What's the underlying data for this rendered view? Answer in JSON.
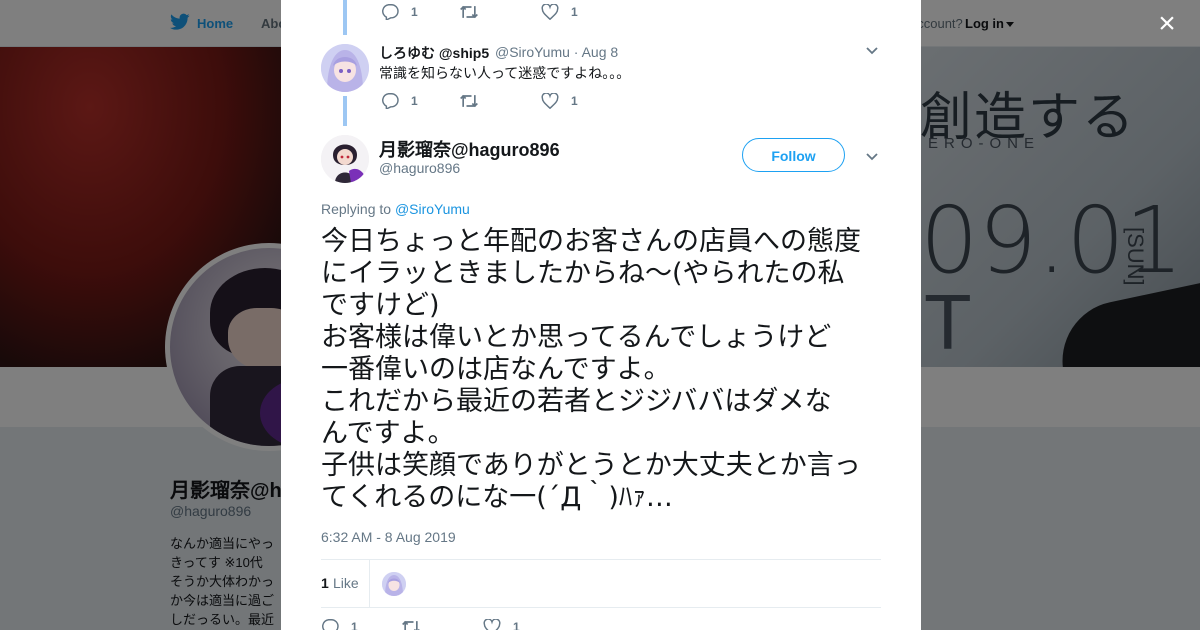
{
  "nav": {
    "home": "Home",
    "about": "Abo",
    "account_prompt": "account?",
    "login": "Log in"
  },
  "banner": {
    "kanji": "創造する",
    "subtitle": "ERO-ONE",
    "date": "09.01",
    "day": "[SUN]",
    "partial": "T"
  },
  "profile": {
    "name": "月影瑠奈@h",
    "handle": "@haguro896",
    "bio": "なんか適当にやっ\nきってす ※10代\nそうか大体わかっ\nか今は適当に過ご\nしだっるい。最近"
  },
  "modal": {
    "close": "×",
    "prev_actions": {
      "reply": "1",
      "retweet": "",
      "like": "1"
    },
    "context_tweet": {
      "name": "しろゆむ @ship5",
      "handle": "@SiroYumu · Aug 8",
      "text": "常識を知らない人って迷惑ですよね。。。",
      "actions": {
        "reply": "1",
        "retweet": "",
        "like": "1"
      }
    },
    "main_tweet": {
      "name": "月影瑠奈@haguro896",
      "handle": "@haguro896",
      "follow": "Follow",
      "replying_prefix": "Replying to",
      "replying_to": "@SiroYumu",
      "text": "今日ちょっと年配のお客さんの店員への態度\nにイラッときましたからね〜(やられたの私\nですけど)\nお客様は偉いとか思ってるんでしょうけど\n一番偉いのは店なんですよ。\nこれだから最近の若者とジジババはダメな\nんですよ。\n子供は笑顔でありがとうとか大丈夫とか言っ\nてくれるのにな一(´Д｀)ﾊｧ…",
      "timestamp": "6:32 AM - 8 Aug 2019",
      "like_count": "1",
      "like_label": "Like",
      "bottom_actions": {
        "reply": "1",
        "retweet": "",
        "like": "1"
      }
    }
  },
  "colors": {
    "accent": "#1da1f2",
    "thread_line": "#9dc7f3",
    "muted": "#657786",
    "text": "#14171a"
  },
  "icons": [
    "twitter-bird-icon",
    "reply-icon",
    "retweet-icon",
    "like-icon",
    "chevron-down-icon",
    "close-icon",
    "caret-down-icon"
  ]
}
